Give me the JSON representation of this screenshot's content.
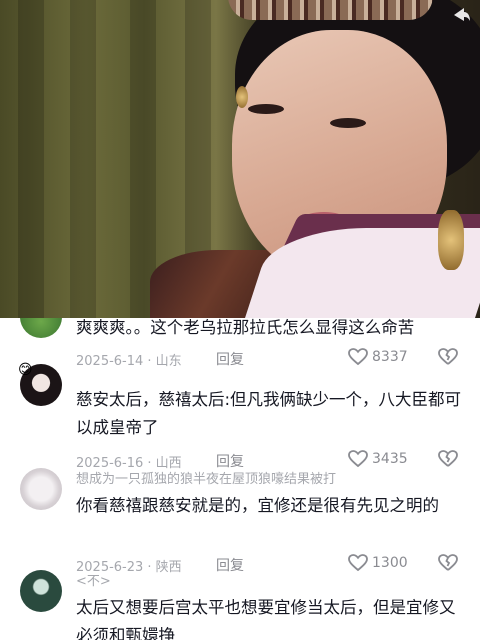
{
  "comments": [
    {
      "text": "爽爽爽。。这个老乌拉那拉氏怎么显得这么命苦",
      "date": "2025-6-14 · 山东",
      "reply": "回复",
      "likes": "8337"
    },
    {
      "text": "慈安太后，慈禧太后:但凡我俩缺少一个，八大臣都可以成皇帝了",
      "date": "2025-6-16 · 山西",
      "reply": "回复",
      "likes": "3435"
    },
    {
      "username": "想成为一只孤独的狼半夜在屋顶狼嚎结果被打",
      "text": "你看慈禧跟慈安就是的，宜修还是很有先见之明的",
      "date": "2025-6-23 · 陕西",
      "reply": "回复",
      "likes": "1300"
    },
    {
      "username": "<不>",
      "text": "太后又想要后宫太平也想要宜修当太后，但是宜修又必须和甄嬛挣"
    }
  ],
  "colors": {
    "text": "#161823",
    "muted": "#a5a7ad"
  },
  "icons": [
    "heart-icon",
    "broken-heart-icon",
    "emoji-icon"
  ]
}
